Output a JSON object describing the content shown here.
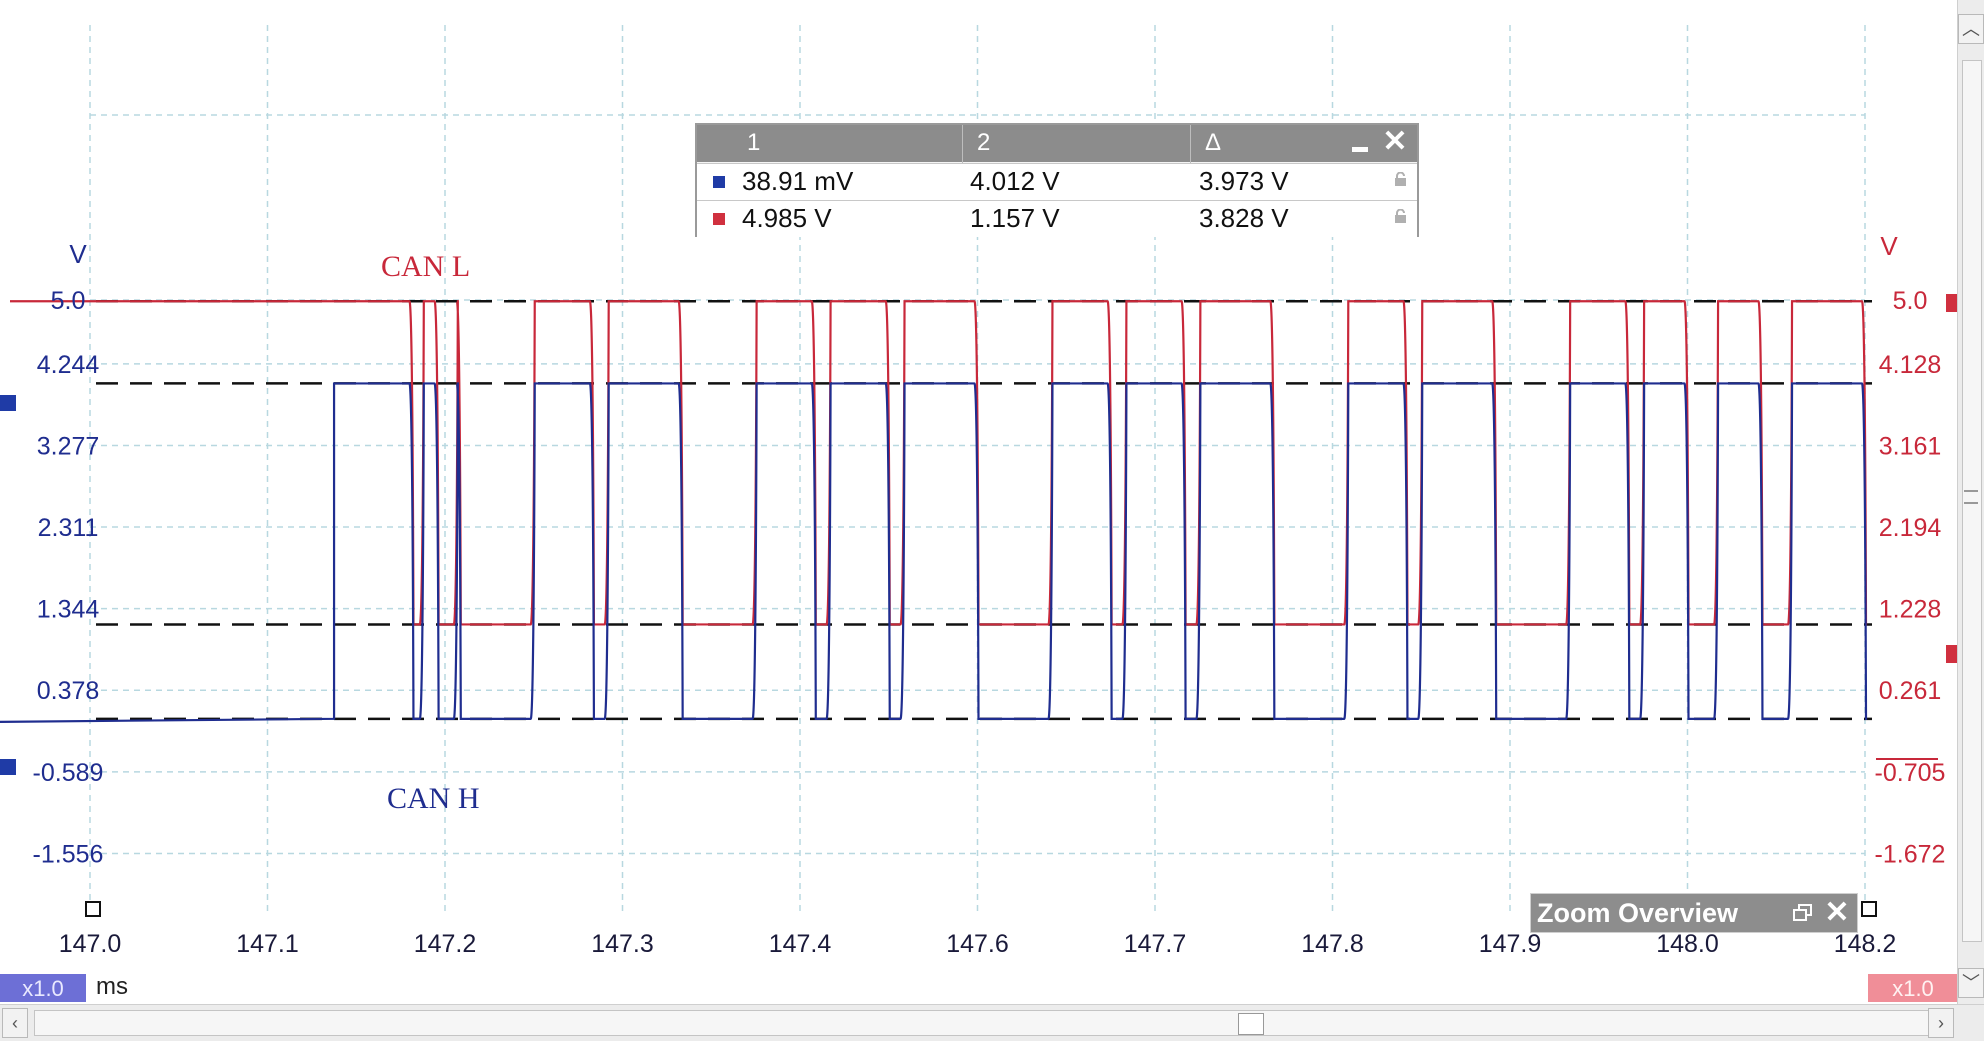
{
  "chart_data": {
    "type": "line",
    "x_unit": "ms",
    "x_ticks": [
      "147.0",
      "147.1",
      "147.2",
      "147.3",
      "147.4",
      "147.6",
      "147.7",
      "147.8",
      "147.9",
      "148.0",
      "148.2"
    ],
    "x_scale_badge": "x1.0",
    "left_axis": {
      "unit": "V",
      "ticks": [
        "5.0",
        "4.244",
        "3.277",
        "2.311",
        "1.344",
        "0.378",
        "-0.589",
        "-1.556"
      ],
      "scale_badge": "x1.0",
      "color": "#1f2d8f"
    },
    "right_axis": {
      "unit": "V",
      "ticks": [
        "5.0",
        "4.128",
        "3.161",
        "2.194",
        "1.228",
        "0.261",
        "-0.705",
        "-1.672"
      ],
      "scale_badge": "x1.0",
      "color": "#c8283a"
    },
    "series": [
      {
        "name": "CAN L",
        "color": "#c8283a",
        "high_value": 4.985,
        "low_value": 1.157
      },
      {
        "name": "CAN H",
        "color": "#1f2d8f",
        "high_value": 4.012,
        "low_value": 0.039
      }
    ],
    "bit_edges_ms": [
      147.165,
      147.218,
      147.225,
      147.235,
      147.248,
      147.25,
      147.3,
      147.34,
      147.35,
      147.4,
      147.45,
      147.49,
      147.5,
      147.54,
      147.55,
      147.6,
      147.65,
      147.69,
      147.7,
      147.74,
      147.75,
      147.8,
      147.85,
      147.89,
      147.9,
      147.95,
      148.0,
      148.04,
      148.05,
      148.08,
      148.1,
      148.13,
      148.15,
      148.2
    ],
    "grid": true
  },
  "measurement_table": {
    "headers": [
      "1",
      "2",
      "Δ"
    ],
    "rows": [
      {
        "channel_color": "#1f3ba6",
        "v1": "38.91 mV",
        "v2": "4.012 V",
        "delta": "3.973 V"
      },
      {
        "channel_color": "#d0303f",
        "v1": "4.985 V",
        "v2": "1.157 V",
        "delta": "3.828 V"
      }
    ]
  },
  "zoom_overview": {
    "title": "Zoom Overview"
  },
  "icons": {
    "minimize": "minimize-icon",
    "close": "close-icon",
    "lock": "lock-icon",
    "restore": "restore-icon",
    "scroll_left": "chevron-left-icon",
    "scroll_right": "chevron-right-icon",
    "scroll_up": "chevron-up-icon",
    "scroll_down": "chevron-down-icon"
  }
}
